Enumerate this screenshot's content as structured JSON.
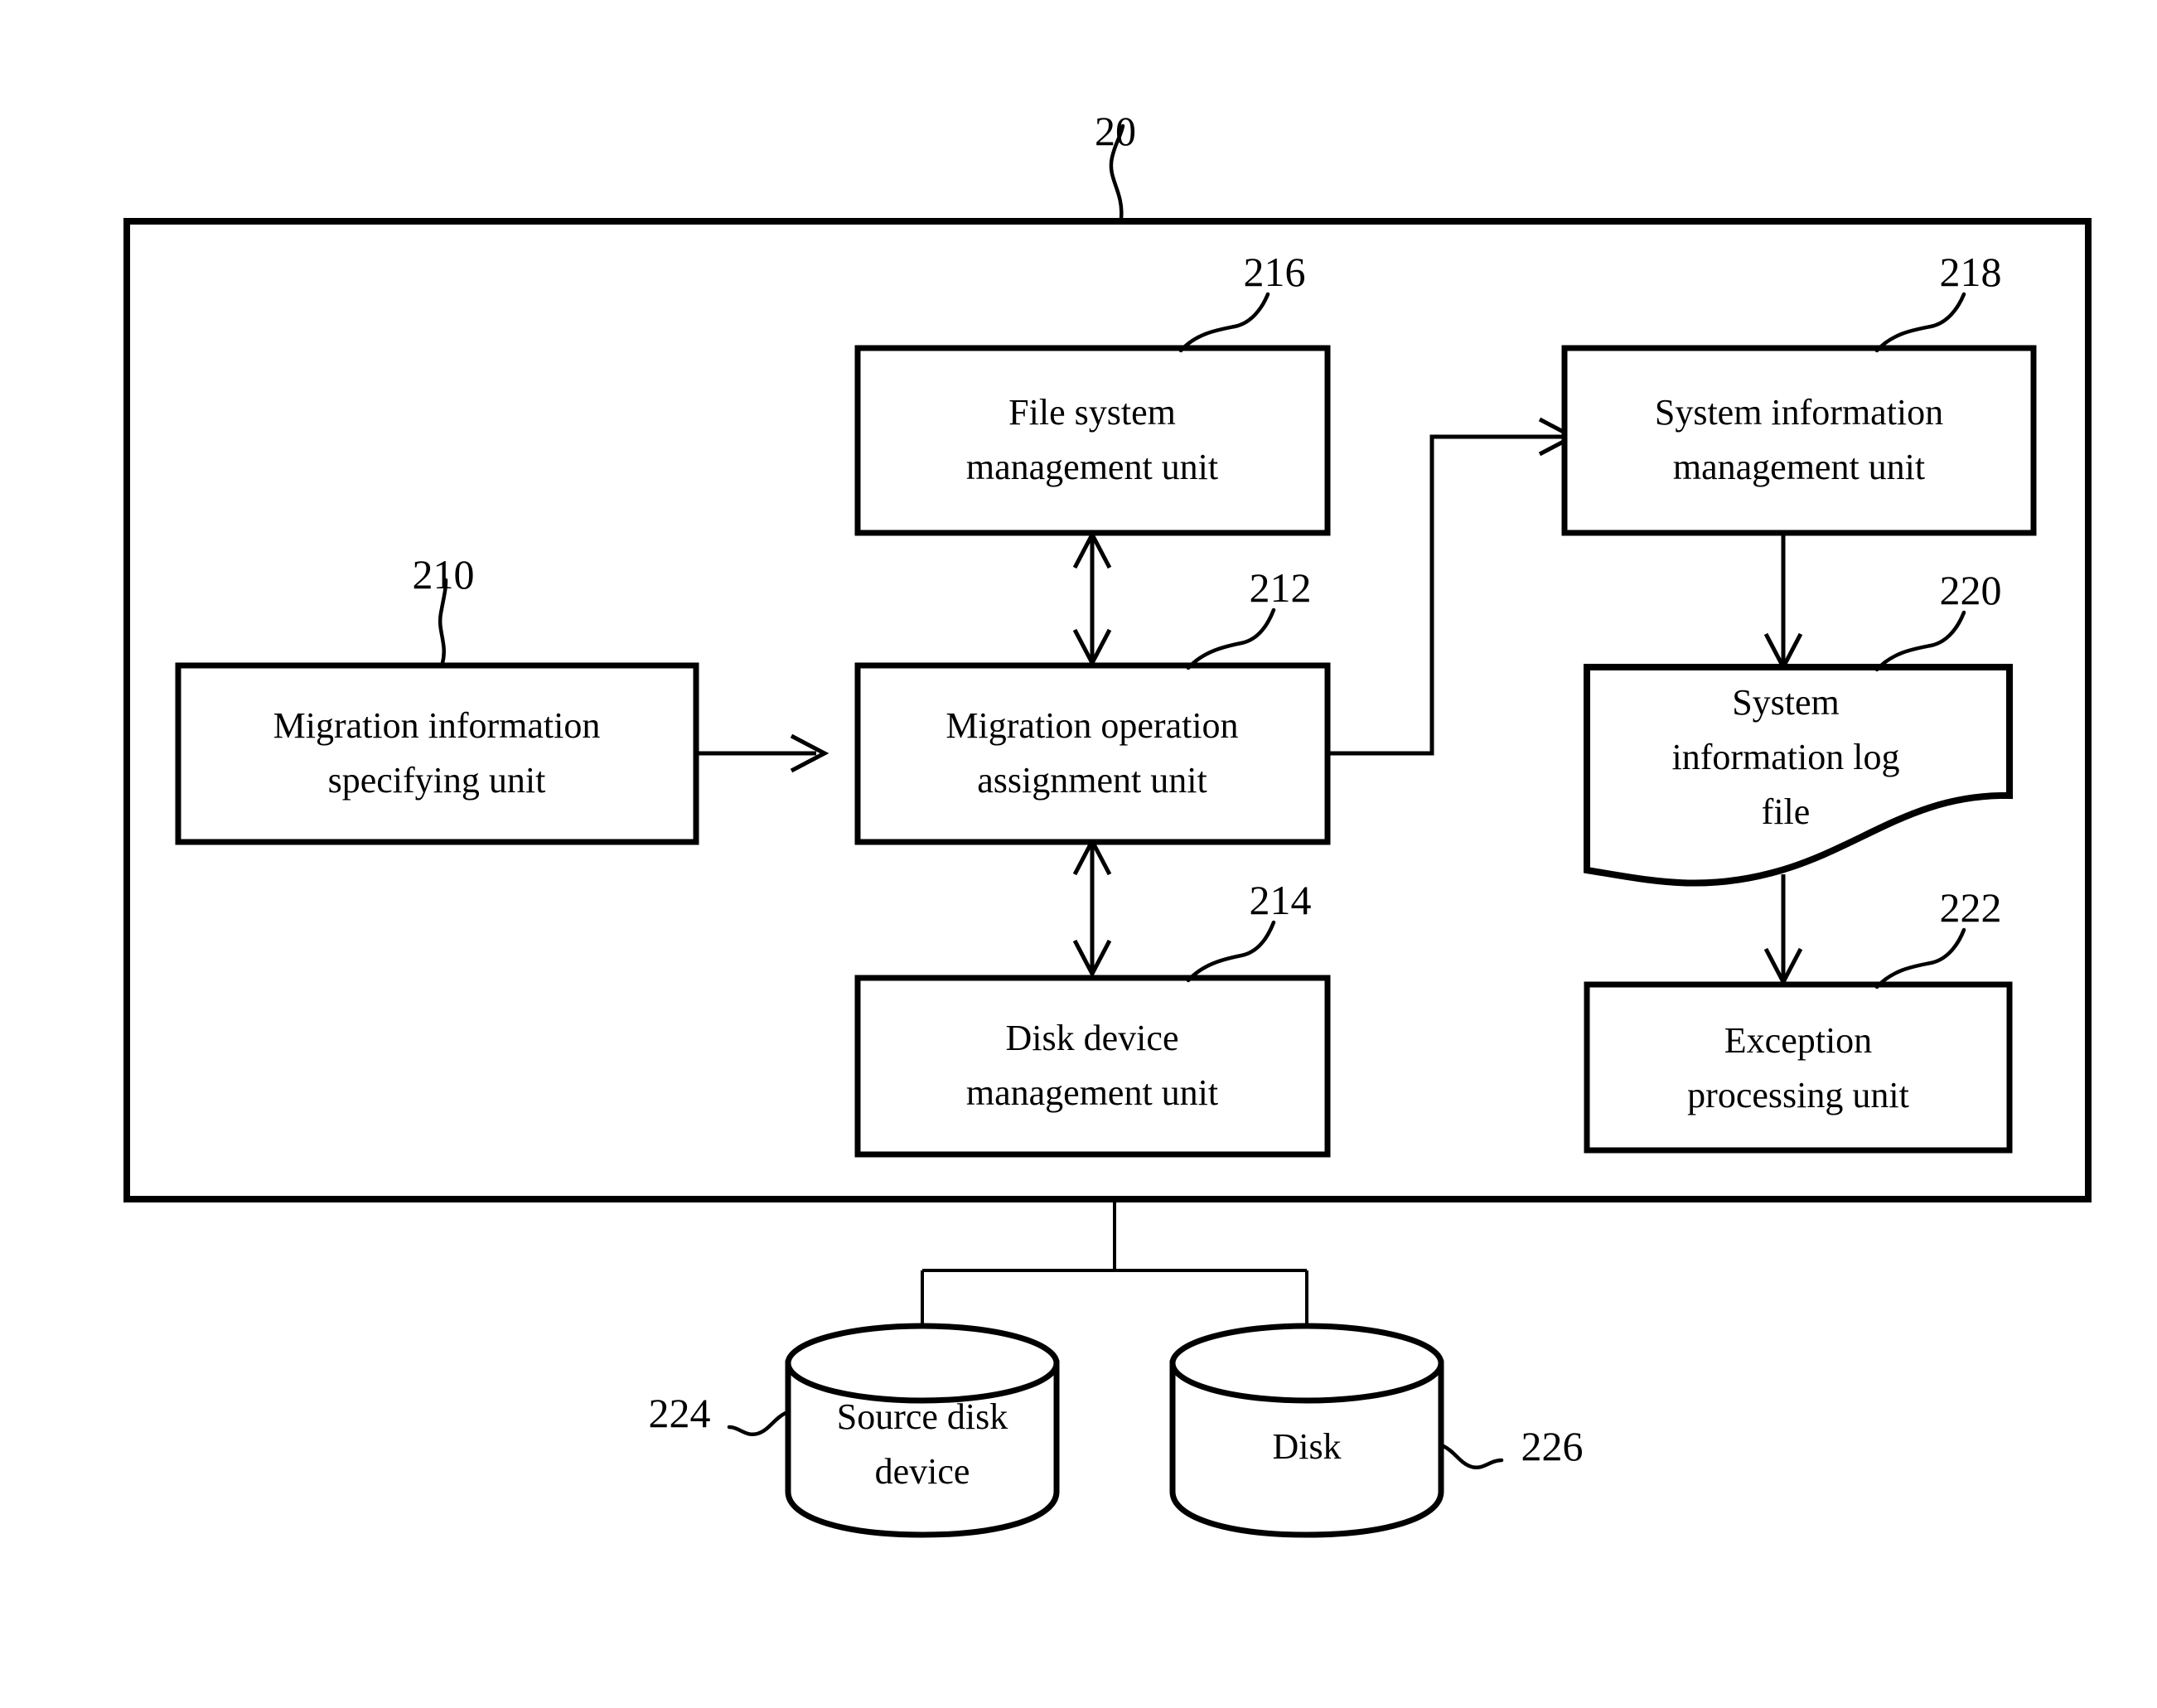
{
  "figure": {
    "system_ref": "20",
    "blocks": [
      {
        "id": "migration-information-specifying-unit",
        "ref": "210",
        "lines": [
          "Migration information",
          "specifying unit"
        ]
      },
      {
        "id": "migration-operation-assignment-unit",
        "ref": "212",
        "lines": [
          "Migration operation",
          "assignment unit"
        ]
      },
      {
        "id": "disk-device-management-unit",
        "ref": "214",
        "lines": [
          "Disk device",
          "management unit"
        ]
      },
      {
        "id": "file-system-management-unit",
        "ref": "216",
        "lines": [
          "File system",
          "management unit"
        ]
      },
      {
        "id": "system-information-management-unit",
        "ref": "218",
        "lines": [
          "System information",
          "management unit"
        ]
      },
      {
        "id": "system-information-log-file",
        "ref": "220",
        "lines": [
          "System",
          "information log",
          "file"
        ]
      },
      {
        "id": "exception-processing-unit",
        "ref": "222",
        "lines": [
          "Exception",
          "processing unit"
        ]
      }
    ],
    "storage": [
      {
        "id": "source-disk-device",
        "ref": "224",
        "lines": [
          "Source disk",
          "device"
        ]
      },
      {
        "id": "disk",
        "ref": "226",
        "lines": [
          "Disk"
        ]
      }
    ],
    "colors": {
      "ink": "#000000",
      "paper": "#ffffff"
    }
  }
}
